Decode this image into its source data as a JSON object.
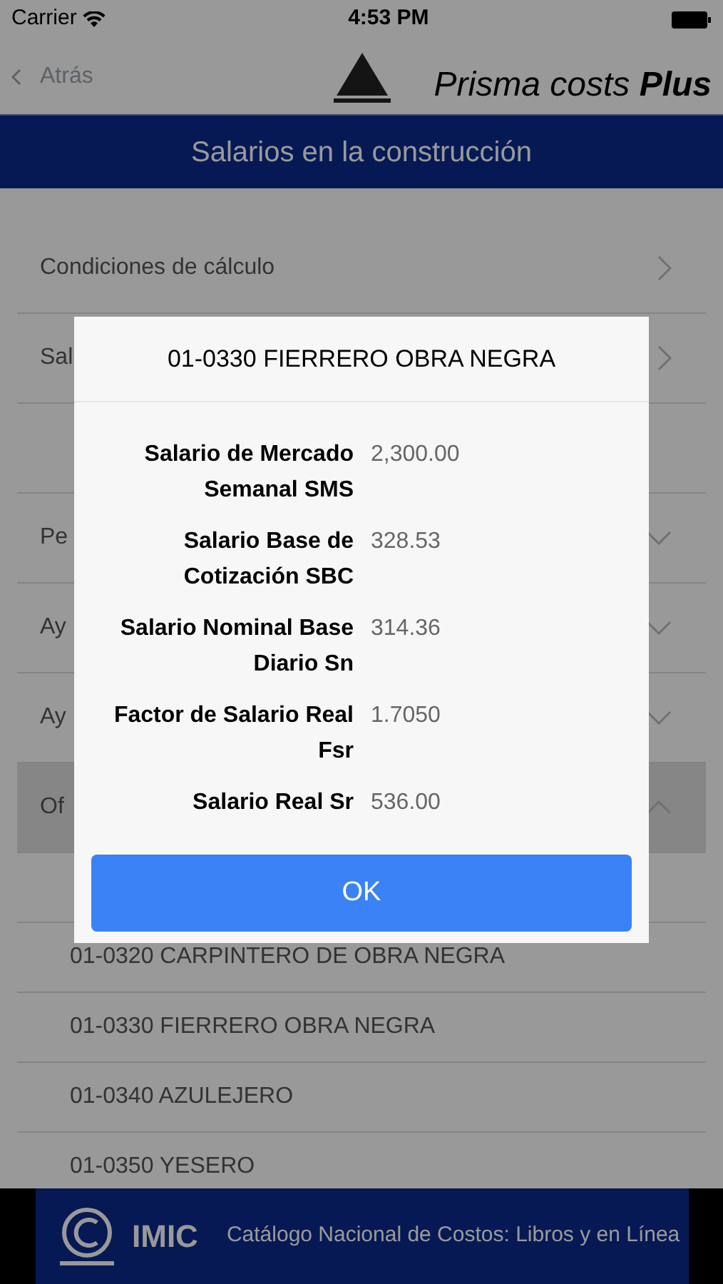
{
  "status_bar": {
    "carrier": "Carrier",
    "time": "4:53 PM"
  },
  "nav": {
    "back": "Atrás",
    "brand_light": "Prisma costs",
    "brand_bold": "Plus"
  },
  "header": {
    "title": "Salarios en la construcción"
  },
  "sections": [
    {
      "label": "Condiciones de cálculo",
      "kind": "link"
    },
    {
      "label": "Sal",
      "kind": "link"
    },
    {
      "kind": "blank"
    },
    {
      "label": "Pe",
      "kind": "accordion",
      "expanded": false
    },
    {
      "label": "Ay",
      "kind": "accordion",
      "expanded": false
    },
    {
      "label": "Ay",
      "kind": "accordion",
      "expanded": false
    },
    {
      "label": "Of",
      "kind": "accordion",
      "expanded": true
    }
  ],
  "sub_items": [
    {
      "kind": "blank"
    },
    {
      "kind": "item",
      "label": "01-0320 CARPINTERO DE OBRA NEGRA"
    },
    {
      "kind": "item",
      "label": "01-0330 FIERRERO OBRA NEGRA"
    },
    {
      "kind": "item",
      "label": "01-0340 AZULEJERO"
    },
    {
      "kind": "item",
      "label": "01-0350 YESERO"
    }
  ],
  "footer": {
    "brand": "IMIC",
    "tagline": "Catálogo Nacional de Costos: Libros y en Línea"
  },
  "dialog": {
    "title": "01-0330 FIERRERO OBRA NEGRA",
    "fields": [
      {
        "label": "Salario de Mercado Semanal SMS",
        "value": "2,300.00"
      },
      {
        "label": "Salario Base de Cotización SBC",
        "value": "328.53"
      },
      {
        "label": "Salario Nominal Base Diario Sn",
        "value": "314.36"
      },
      {
        "label": "Factor de Salario Real Fsr",
        "value": "1.7050"
      },
      {
        "label": "Salario Real Sr",
        "value": "536.00"
      }
    ],
    "button": "OK"
  }
}
